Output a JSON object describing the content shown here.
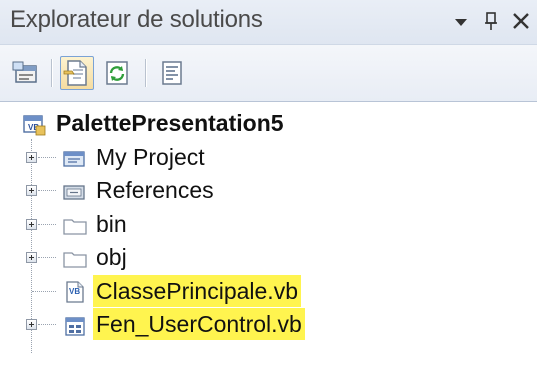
{
  "window": {
    "title": "Explorateur de solutions",
    "buttons": [
      {
        "name": "dropdown-icon",
        "glyph": "▾"
      },
      {
        "name": "pin-icon",
        "glyph": "ᵃ"
      },
      {
        "name": "close-icon",
        "glyph": "✕"
      }
    ]
  },
  "toolbar": {
    "items": [
      {
        "name": "properties-icon",
        "active": false
      },
      {
        "name": "show-all-files-icon",
        "active": true
      },
      {
        "name": "refresh-icon",
        "active": false
      },
      {
        "name": "view-code-icon",
        "active": false
      }
    ]
  },
  "tree": {
    "root": {
      "label": "PalettePresentation5",
      "icon": "vb-project-icon"
    },
    "items": [
      {
        "label": "My Project",
        "icon": "my-project-icon",
        "expandable": true,
        "highlighted": false
      },
      {
        "label": "References",
        "icon": "references-icon",
        "expandable": true,
        "highlighted": false
      },
      {
        "label": "bin",
        "icon": "folder-icon",
        "expandable": true,
        "highlighted": false
      },
      {
        "label": "obj",
        "icon": "folder-icon",
        "expandable": true,
        "highlighted": false
      },
      {
        "label": "ClassePrincipale.vb",
        "icon": "vb-file-icon",
        "expandable": false,
        "highlighted": true
      },
      {
        "label": "Fen_UserControl.vb",
        "icon": "usercontrol-icon",
        "expandable": true,
        "highlighted": true
      }
    ]
  },
  "colors": {
    "highlight": "#fff44f",
    "titlebar": "#e3e9f3",
    "active_button": "#f5dca0"
  }
}
